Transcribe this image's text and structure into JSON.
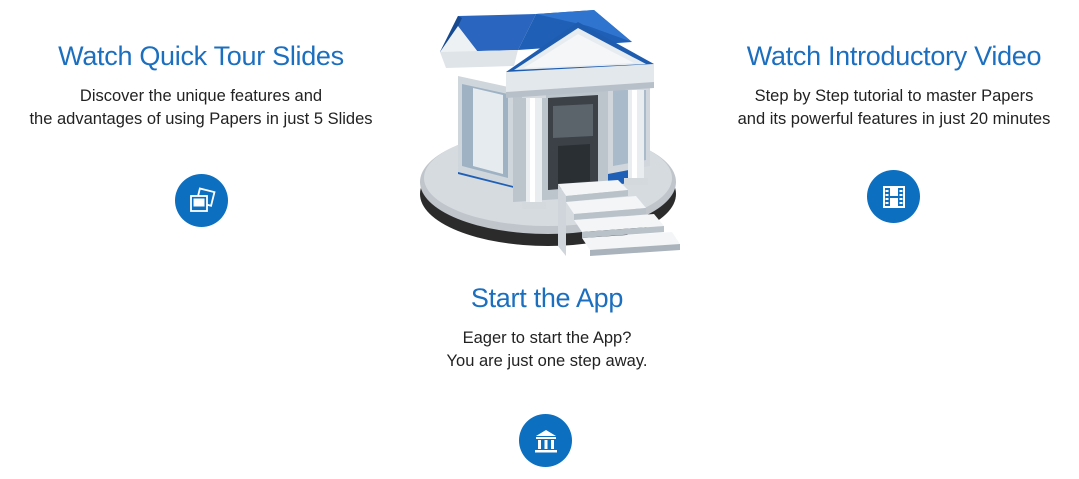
{
  "tour": {
    "title": "Watch Quick Tour Slides",
    "line1": "Discover the unique features and",
    "line2": "the advantages of using Papers in just 5 Slides",
    "icon": "photo-slides-icon"
  },
  "video": {
    "title": "Watch Introductory Video",
    "line1": "Step by Step tutorial to master Papers",
    "line2": "and its powerful features in just 20 minutes",
    "icon": "film-strip-icon"
  },
  "app": {
    "title": "Start the App",
    "line1": "Eager to start the App?",
    "line2": "You are just one step away.",
    "icon": "library-building-icon"
  },
  "colors": {
    "accent": "#1c6fbf",
    "button": "#0d6fc0",
    "roof": "#1f5fb5",
    "text": "#222222"
  }
}
